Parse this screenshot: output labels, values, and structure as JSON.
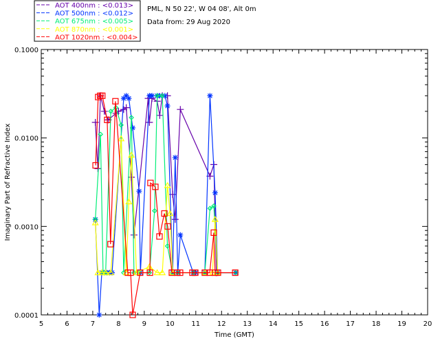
{
  "chart_data": {
    "type": "line",
    "xlabel": "Time (GMT)",
    "ylabel": "Imaginary Part of Refractive Index",
    "xlim": [
      5,
      20
    ],
    "ylim": [
      0.0001,
      0.1
    ],
    "yscale": "log",
    "grid": false,
    "legend_placement": "top-left",
    "x_ticks": [
      "5",
      "6",
      "7",
      "8",
      "9",
      "10",
      "11",
      "12",
      "13",
      "14",
      "15",
      "16",
      "17",
      "18",
      "19",
      "20"
    ],
    "y_ticks": [
      "0.0001",
      "0.0010",
      "0.0100",
      "0.1000"
    ],
    "annotations": [
      "PML, N 50 22', W 04 08', Alt 0m",
      "Data from: 29 Aug 2020"
    ],
    "series": [
      {
        "name": "AOT  400nm : <0.013>",
        "color": "#6600aa",
        "marker": "plus",
        "x": [
          7.1,
          7.2,
          7.3,
          7.45,
          7.6,
          7.9,
          8.0,
          8.2,
          8.3,
          8.5,
          8.6,
          9.15,
          9.2,
          9.3,
          9.5,
          9.6,
          9.7,
          9.9,
          10.1,
          10.2,
          10.4,
          11.55,
          11.7,
          11.8
        ],
        "y": [
          0.015,
          0.0045,
          0.03,
          0.02,
          0.016,
          0.019,
          0.02,
          0.021,
          0.022,
          0.0036,
          0.0008,
          0.028,
          0.015,
          0.028,
          0.026,
          0.018,
          0.03,
          0.03,
          0.0023,
          0.0012,
          0.021,
          0.0037,
          0.005,
          0.0003
        ]
      },
      {
        "name": "AOT  500nm : <0.012>",
        "color": "#0033ff",
        "marker": "star",
        "x": [
          7.1,
          7.25,
          7.35,
          7.45,
          7.55,
          7.65,
          7.75,
          8.2,
          8.3,
          8.4,
          8.55,
          8.8,
          8.85,
          9.2,
          9.3,
          9.5,
          9.6,
          9.8,
          9.9,
          10.1,
          10.2,
          10.3,
          10.4,
          10.9,
          11.0,
          11.35,
          11.55,
          11.75,
          11.85,
          12.55
        ],
        "y": [
          0.0012,
          0.0001,
          0.0003,
          0.0003,
          0.0003,
          0.0003,
          0.0003,
          0.028,
          0.03,
          0.028,
          0.013,
          0.0025,
          0.0003,
          0.03,
          0.03,
          0.03,
          0.03,
          0.03,
          0.023,
          0.0003,
          0.006,
          0.0003,
          0.0008,
          0.0003,
          0.0003,
          0.0003,
          0.03,
          0.0024,
          0.0003,
          0.0003
        ]
      },
      {
        "name": "AOT  675nm : <0.005>",
        "color": "#00ee77",
        "marker": "diamond",
        "x": [
          7.1,
          7.3,
          7.4,
          7.5,
          7.7,
          7.9,
          8.1,
          8.2,
          8.5,
          8.6,
          8.8,
          9.2,
          9.4,
          9.5,
          9.7,
          9.9,
          10.1,
          10.3,
          10.9,
          11.35,
          11.55,
          11.7,
          11.85,
          12.55
        ],
        "y": [
          0.0012,
          0.011,
          0.0003,
          0.0003,
          0.02,
          0.022,
          0.014,
          0.0003,
          0.017,
          0.0003,
          0.0003,
          0.0003,
          0.0015,
          0.03,
          0.03,
          0.0006,
          0.0003,
          0.0003,
          0.0003,
          0.0003,
          0.0016,
          0.0017,
          0.0003,
          0.0003
        ]
      },
      {
        "name": "AOT  870nm : <0.001>",
        "color": "#ffff00",
        "marker": "triangle",
        "x": [
          7.1,
          7.2,
          7.35,
          7.5,
          7.7,
          8.1,
          8.3,
          8.4,
          8.5,
          8.7,
          9.2,
          9.5,
          9.7,
          9.9,
          10.0,
          10.1,
          11.35,
          11.65,
          11.75,
          11.85
        ],
        "y": [
          0.0011,
          0.0003,
          0.0003,
          0.0003,
          0.0003,
          0.0098,
          0.0003,
          0.0019,
          0.0064,
          0.0003,
          0.00035,
          0.0003,
          0.0003,
          0.0029,
          0.0014,
          0.0003,
          0.0003,
          0.0003,
          0.0012,
          0.0003
        ]
      },
      {
        "name": "AOT 1020nm : <0.004>",
        "color": "#ff0000",
        "marker": "square",
        "x": [
          7.11,
          7.21,
          7.29,
          7.37,
          7.56,
          7.69,
          7.88,
          8.36,
          8.47,
          8.55,
          8.84,
          9.22,
          9.24,
          9.43,
          9.59,
          9.78,
          9.91,
          10.07,
          10.28,
          10.39,
          10.87,
          10.98,
          11.35,
          11.54,
          11.7,
          11.75,
          11.86,
          12.53
        ],
        "y": [
          0.0049,
          0.029,
          0.03,
          0.03,
          0.016,
          0.00063,
          0.026,
          0.0003,
          0.0003,
          0.0001,
          0.0003,
          0.0003,
          0.0031,
          0.0028,
          0.00077,
          0.0014,
          0.001,
          0.0003,
          0.0003,
          0.0003,
          0.0003,
          0.0003,
          0.0003,
          0.0003,
          0.00085,
          0.0003,
          0.0003,
          0.0003
        ]
      }
    ]
  }
}
